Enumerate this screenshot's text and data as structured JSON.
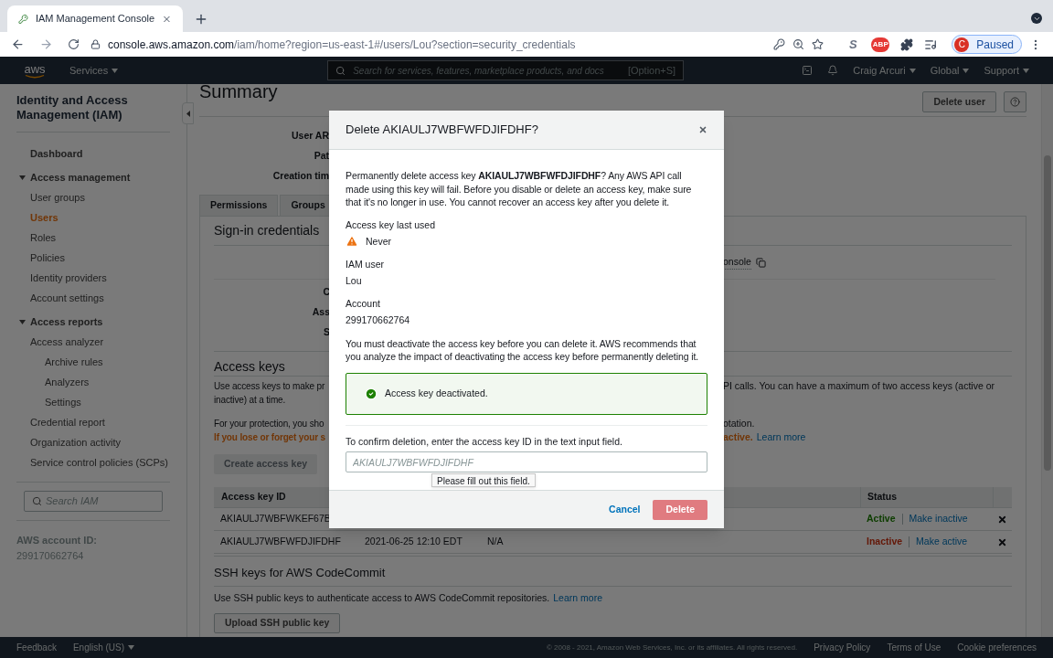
{
  "browser": {
    "tab_title": "IAM Management Console",
    "url_host": "console.aws.amazon.com",
    "url_path": "/iam/home?region=us-east-1#/users/Lou?section=security_credentials",
    "extensions": [
      {
        "kind": "letter",
        "label": "S"
      },
      {
        "kind": "adblock",
        "label": "ABP"
      },
      {
        "kind": "puzzle"
      },
      {
        "kind": "media"
      }
    ],
    "profile": {
      "initial": "C",
      "label": "Paused"
    }
  },
  "aws_nav": {
    "logo": "aws",
    "services": "Services",
    "search_placeholder": "Search for services, features, marketplace products, and docs",
    "shortcut": "[Option+S]",
    "menus": [
      "Craig Arcuri",
      "Global",
      "Support"
    ]
  },
  "sidebar": {
    "title": "Identity and Access Management (IAM)",
    "items": [
      {
        "kind": "link",
        "label": "Dashboard",
        "selected": false
      },
      {
        "kind": "section",
        "label": "Access management",
        "expanded": true,
        "children": [
          {
            "kind": "link",
            "label": "User groups",
            "selected": false
          },
          {
            "kind": "link",
            "label": "Users",
            "selected": true
          },
          {
            "kind": "link",
            "label": "Roles",
            "selected": false
          },
          {
            "kind": "link",
            "label": "Policies",
            "selected": false
          },
          {
            "kind": "link",
            "label": "Identity providers",
            "selected": false
          },
          {
            "kind": "link",
            "label": "Account settings",
            "selected": false
          }
        ]
      },
      {
        "kind": "section",
        "label": "Access reports",
        "expanded": true,
        "children": [
          {
            "kind": "link",
            "label": "Access analyzer",
            "selected": false,
            "children": [
              {
                "kind": "link",
                "label": "Archive rules",
                "selected": false
              },
              {
                "kind": "link",
                "label": "Analyzers",
                "selected": false
              },
              {
                "kind": "link",
                "label": "Settings",
                "selected": false
              }
            ]
          },
          {
            "kind": "link",
            "label": "Credential report",
            "selected": false
          },
          {
            "kind": "link",
            "label": "Organization activity",
            "selected": false
          },
          {
            "kind": "link",
            "label": "Service control policies (SCPs)",
            "selected": false
          }
        ]
      }
    ],
    "search_placeholder": "Search IAM",
    "account_label": "AWS account ID:",
    "account_id": "299170662764"
  },
  "summary": {
    "title": "Summary",
    "delete_user": "Delete user",
    "fields": [
      "User AR",
      "Pat",
      "Creation tim"
    ],
    "tabs": [
      {
        "label": "Permissions",
        "selected": false
      },
      {
        "label": "Groups",
        "selected": false
      }
    ]
  },
  "sign_in": {
    "title": "Sign-in credentials",
    "console_fragment": "onsole",
    "labels": [
      "C",
      "Ass",
      "S"
    ]
  },
  "access_keys": {
    "title": "Access keys",
    "lines": [
      {
        "kind": "plain",
        "left": "Use access keys to make pr",
        "right": "PI calls. You can have a maximum of two access keys (active or"
      },
      {
        "kind": "plain",
        "left": "inactive) at a time."
      },
      {
        "kind": "plain",
        "left": "For your protection, you sho",
        "right": "otation."
      },
      {
        "kind": "warning",
        "left": "If you lose or forget your s",
        "right": "active.",
        "link": "Learn more"
      }
    ],
    "create_button": {
      "label": "Create access key",
      "disabled": true
    },
    "columns": [
      "Access key ID",
      "Status"
    ],
    "rows": [
      {
        "key_id": "AKIAULJ7WBFWKEF67B",
        "status": "Active",
        "active": true,
        "toggle": "Make inactive"
      },
      {
        "key_id": "AKIAULJ7WBFWFDJIFDHF",
        "created": "2021-06-25 12:10 EDT",
        "last_used": "N/A",
        "status": "Inactive",
        "active": false,
        "toggle": "Make active"
      }
    ]
  },
  "ssh": {
    "title": "SSH keys for AWS CodeCommit",
    "text": "Use SSH public keys to authenticate access to AWS CodeCommit repositories.",
    "link": "Learn more",
    "button": "Upload SSH public key"
  },
  "modal": {
    "title": "Delete AKIAULJ7WBFWFDJIFDHF?",
    "intro": "Permanently delete access key **AKIAULJ7WBFWFDJIFDHF**? Any AWS API call made using this key will fail. Before you disable or delete an access key, make sure that it's no longer in use. You cannot recover an access key after you delete it.",
    "fields": [
      {
        "label": "Access key last used",
        "value": "Never",
        "kind": "warning"
      },
      {
        "label": "IAM user",
        "value": "Lou",
        "kind": "plain"
      },
      {
        "label": "Account",
        "value": "299170662764",
        "kind": "plain"
      }
    ],
    "notice": "You must deactivate the access key before you can delete it. AWS recommends that you analyze the impact of deactivating the access key before permanently deleting it.",
    "alert": {
      "kind": "success",
      "text": "Access key deactivated."
    },
    "confirm_label": "To confirm deletion, enter the access key ID in the text input field.",
    "placeholder": "AKIAULJ7WBFWFDJIFDHF",
    "tooltip": "Please fill out this field.",
    "cancel": "Cancel",
    "delete": {
      "label": "Delete",
      "disabled": true
    }
  },
  "footer": {
    "feedback": "Feedback",
    "language": "English (US)",
    "copyright": "© 2008 - 2021, Amazon Web Services, Inc. or its affiliates. All rights reserved.",
    "links": [
      "Privacy Policy",
      "Terms of Use",
      "Cookie preferences"
    ]
  }
}
